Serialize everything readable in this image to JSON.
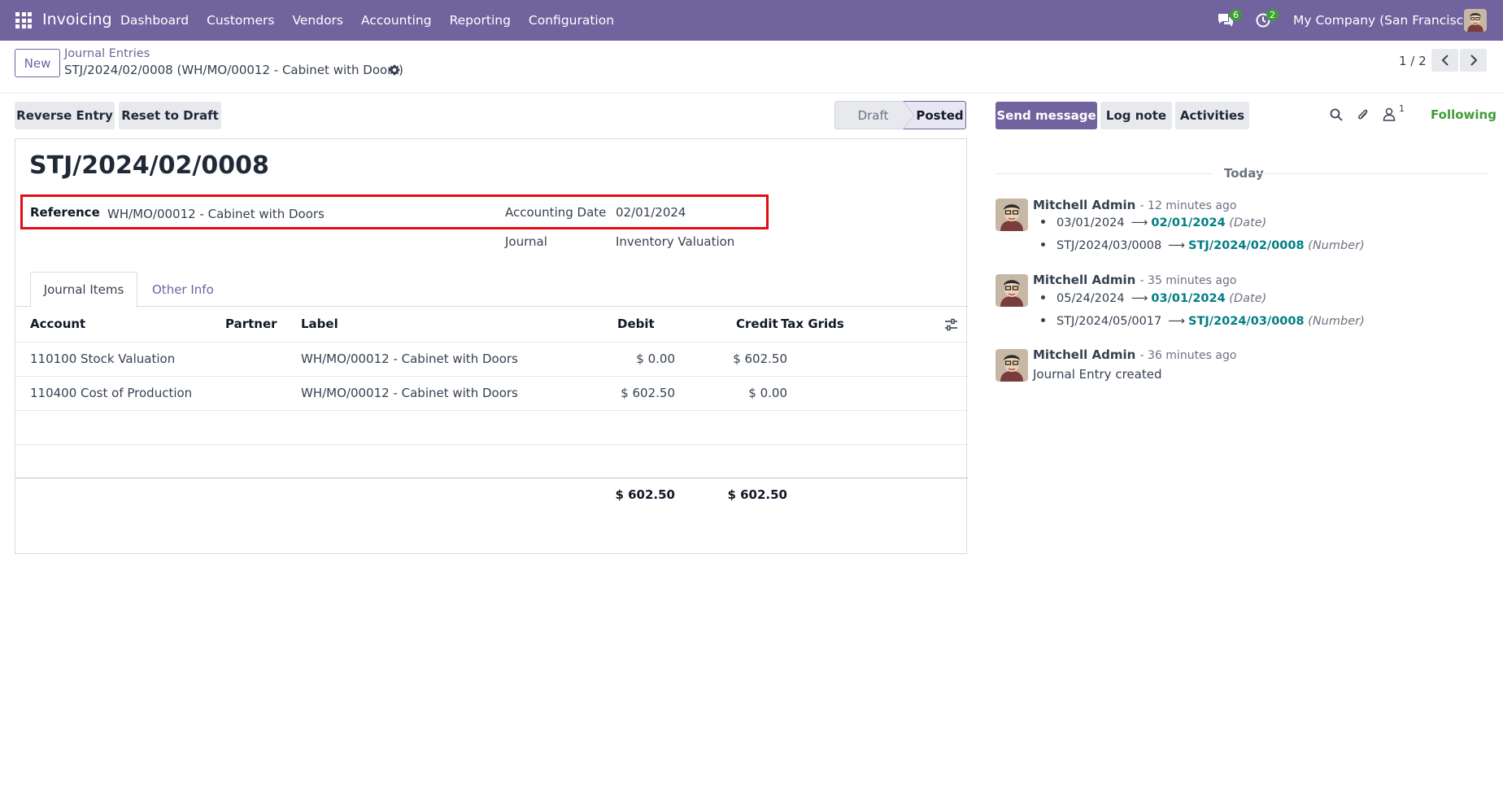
{
  "navbar": {
    "app_name": "Invoicing",
    "menu": [
      "Dashboard",
      "Customers",
      "Vendors",
      "Accounting",
      "Reporting",
      "Configuration"
    ],
    "messages_badge": "6",
    "activities_badge": "2",
    "company": "My Company (San Francisco)"
  },
  "control": {
    "new_label": "New",
    "breadcrumb_parent": "Journal Entries",
    "breadcrumb_current": "STJ/2024/02/0008 (WH/MO/00012 - Cabinet with Doors)",
    "pager": "1 / 2"
  },
  "actions": {
    "reverse_entry": "Reverse Entry",
    "reset_to_draft": "Reset to Draft"
  },
  "status": {
    "draft": "Draft",
    "posted": "Posted"
  },
  "form": {
    "title": "STJ/2024/02/0008",
    "reference_label": "Reference",
    "reference_value": "WH/MO/00012 - Cabinet with Doors",
    "accounting_date_label": "Accounting Date",
    "accounting_date_value": "02/01/2024",
    "journal_label": "Journal",
    "journal_value": "Inventory Valuation"
  },
  "tabs": {
    "journal_items": "Journal Items",
    "other_info": "Other Info"
  },
  "table": {
    "headers": {
      "account": "Account",
      "partner": "Partner",
      "label": "Label",
      "debit": "Debit",
      "credit": "Credit",
      "tax_grids": "Tax Grids"
    },
    "rows": [
      {
        "account": "110100 Stock Valuation",
        "partner": "",
        "label": "WH/MO/00012 - Cabinet with Doors",
        "debit": "$ 0.00",
        "credit": "$ 602.50"
      },
      {
        "account": "110400 Cost of Production",
        "partner": "",
        "label": "WH/MO/00012 - Cabinet with Doors",
        "debit": "$ 602.50",
        "credit": "$ 0.00"
      }
    ],
    "total_debit": "$ 602.50",
    "total_credit": "$ 602.50"
  },
  "chatter": {
    "send_message": "Send message",
    "log_note": "Log note",
    "activities": "Activities",
    "followers_count": "1",
    "following": "Following",
    "today": "Today",
    "messages": [
      {
        "author": "Mitchell Admin",
        "time": "- 12 minutes ago",
        "tracking": [
          {
            "old": "03/01/2024",
            "new": "02/01/2024",
            "field": "(Date)"
          },
          {
            "old": "STJ/2024/03/0008",
            "new": "STJ/2024/02/0008",
            "field": "(Number)"
          }
        ]
      },
      {
        "author": "Mitchell Admin",
        "time": "- 35 minutes ago",
        "tracking": [
          {
            "old": "05/24/2024",
            "new": "03/01/2024",
            "field": "(Date)"
          },
          {
            "old": "STJ/2024/05/0017",
            "new": "STJ/2024/03/0008",
            "field": "(Number)"
          }
        ]
      },
      {
        "author": "Mitchell Admin",
        "time": "- 36 minutes ago",
        "body": "Journal Entry created"
      }
    ]
  }
}
